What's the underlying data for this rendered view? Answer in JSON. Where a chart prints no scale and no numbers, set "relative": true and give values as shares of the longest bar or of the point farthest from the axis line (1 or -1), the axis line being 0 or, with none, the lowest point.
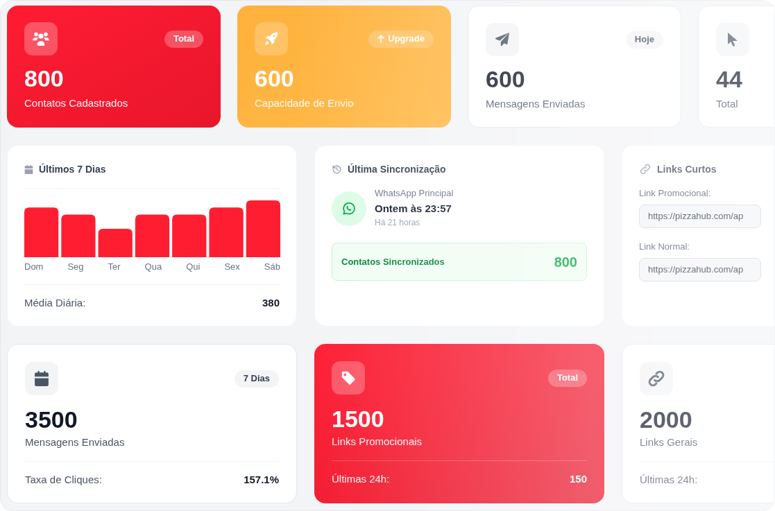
{
  "stat_cards": [
    {
      "kind": "red",
      "badge": {
        "kind": "tag",
        "text": "Total"
      },
      "value": "800",
      "label": "Contatos Cadastrados"
    },
    {
      "kind": "amber",
      "badge": {
        "kind": "action",
        "text": "Upgrade"
      },
      "value": "600",
      "label": "Capacidade de Envio"
    },
    {
      "kind": "white",
      "badge": {
        "kind": "tag",
        "text": "Hoje"
      },
      "value": "600",
      "label": "Mensagens Enviadas"
    },
    {
      "kind": "white",
      "value": "44",
      "label": "Total"
    }
  ],
  "weekly_card": {
    "title": "Últimos 7 Dias",
    "chart_data": {
      "type": "bar",
      "relative": true,
      "categories": [
        "Dom",
        "Seg",
        "Ter",
        "Qua",
        "Qui",
        "Sex",
        "Sáb"
      ],
      "values": [
        0.875,
        0.75,
        0.5,
        0.75,
        0.75,
        0.875,
        1
      ]
    },
    "footer_label": "Média Diária:",
    "footer_value": "380"
  },
  "sync_card": {
    "title": "Última Sincronização",
    "account": "WhatsApp Principal",
    "time": "Ontem às 23:57",
    "ago": "Há 21 horas",
    "synced": {
      "label": "Contatos Sincronizados",
      "value": "800"
    }
  },
  "links_card": {
    "title": "Links Curtos",
    "fields": [
      {
        "label": "Link Promocional:",
        "value": "https://pizzahub.com/ap"
      },
      {
        "label": "Link Normal:",
        "value": "https://pizzahub.com/ap"
      }
    ]
  },
  "bottom_cards": [
    {
      "kind": "white",
      "badge": {
        "kind": "tag",
        "text": "7 Dias"
      },
      "value": "3500",
      "label": "Mensagens Enviadas",
      "footer_label": "Taxa de Cliques:",
      "footer_value": "157.1%"
    },
    {
      "kind": "red",
      "badge": {
        "kind": "tag",
        "text": "Total"
      },
      "value": "1500",
      "label": "Links Promocionais",
      "footer_label": "Últimas 24h:",
      "footer_value": "150"
    },
    {
      "kind": "white",
      "value": "2000",
      "label": "Links Gerais",
      "footer_label": "Últimas 24h:"
    }
  ]
}
